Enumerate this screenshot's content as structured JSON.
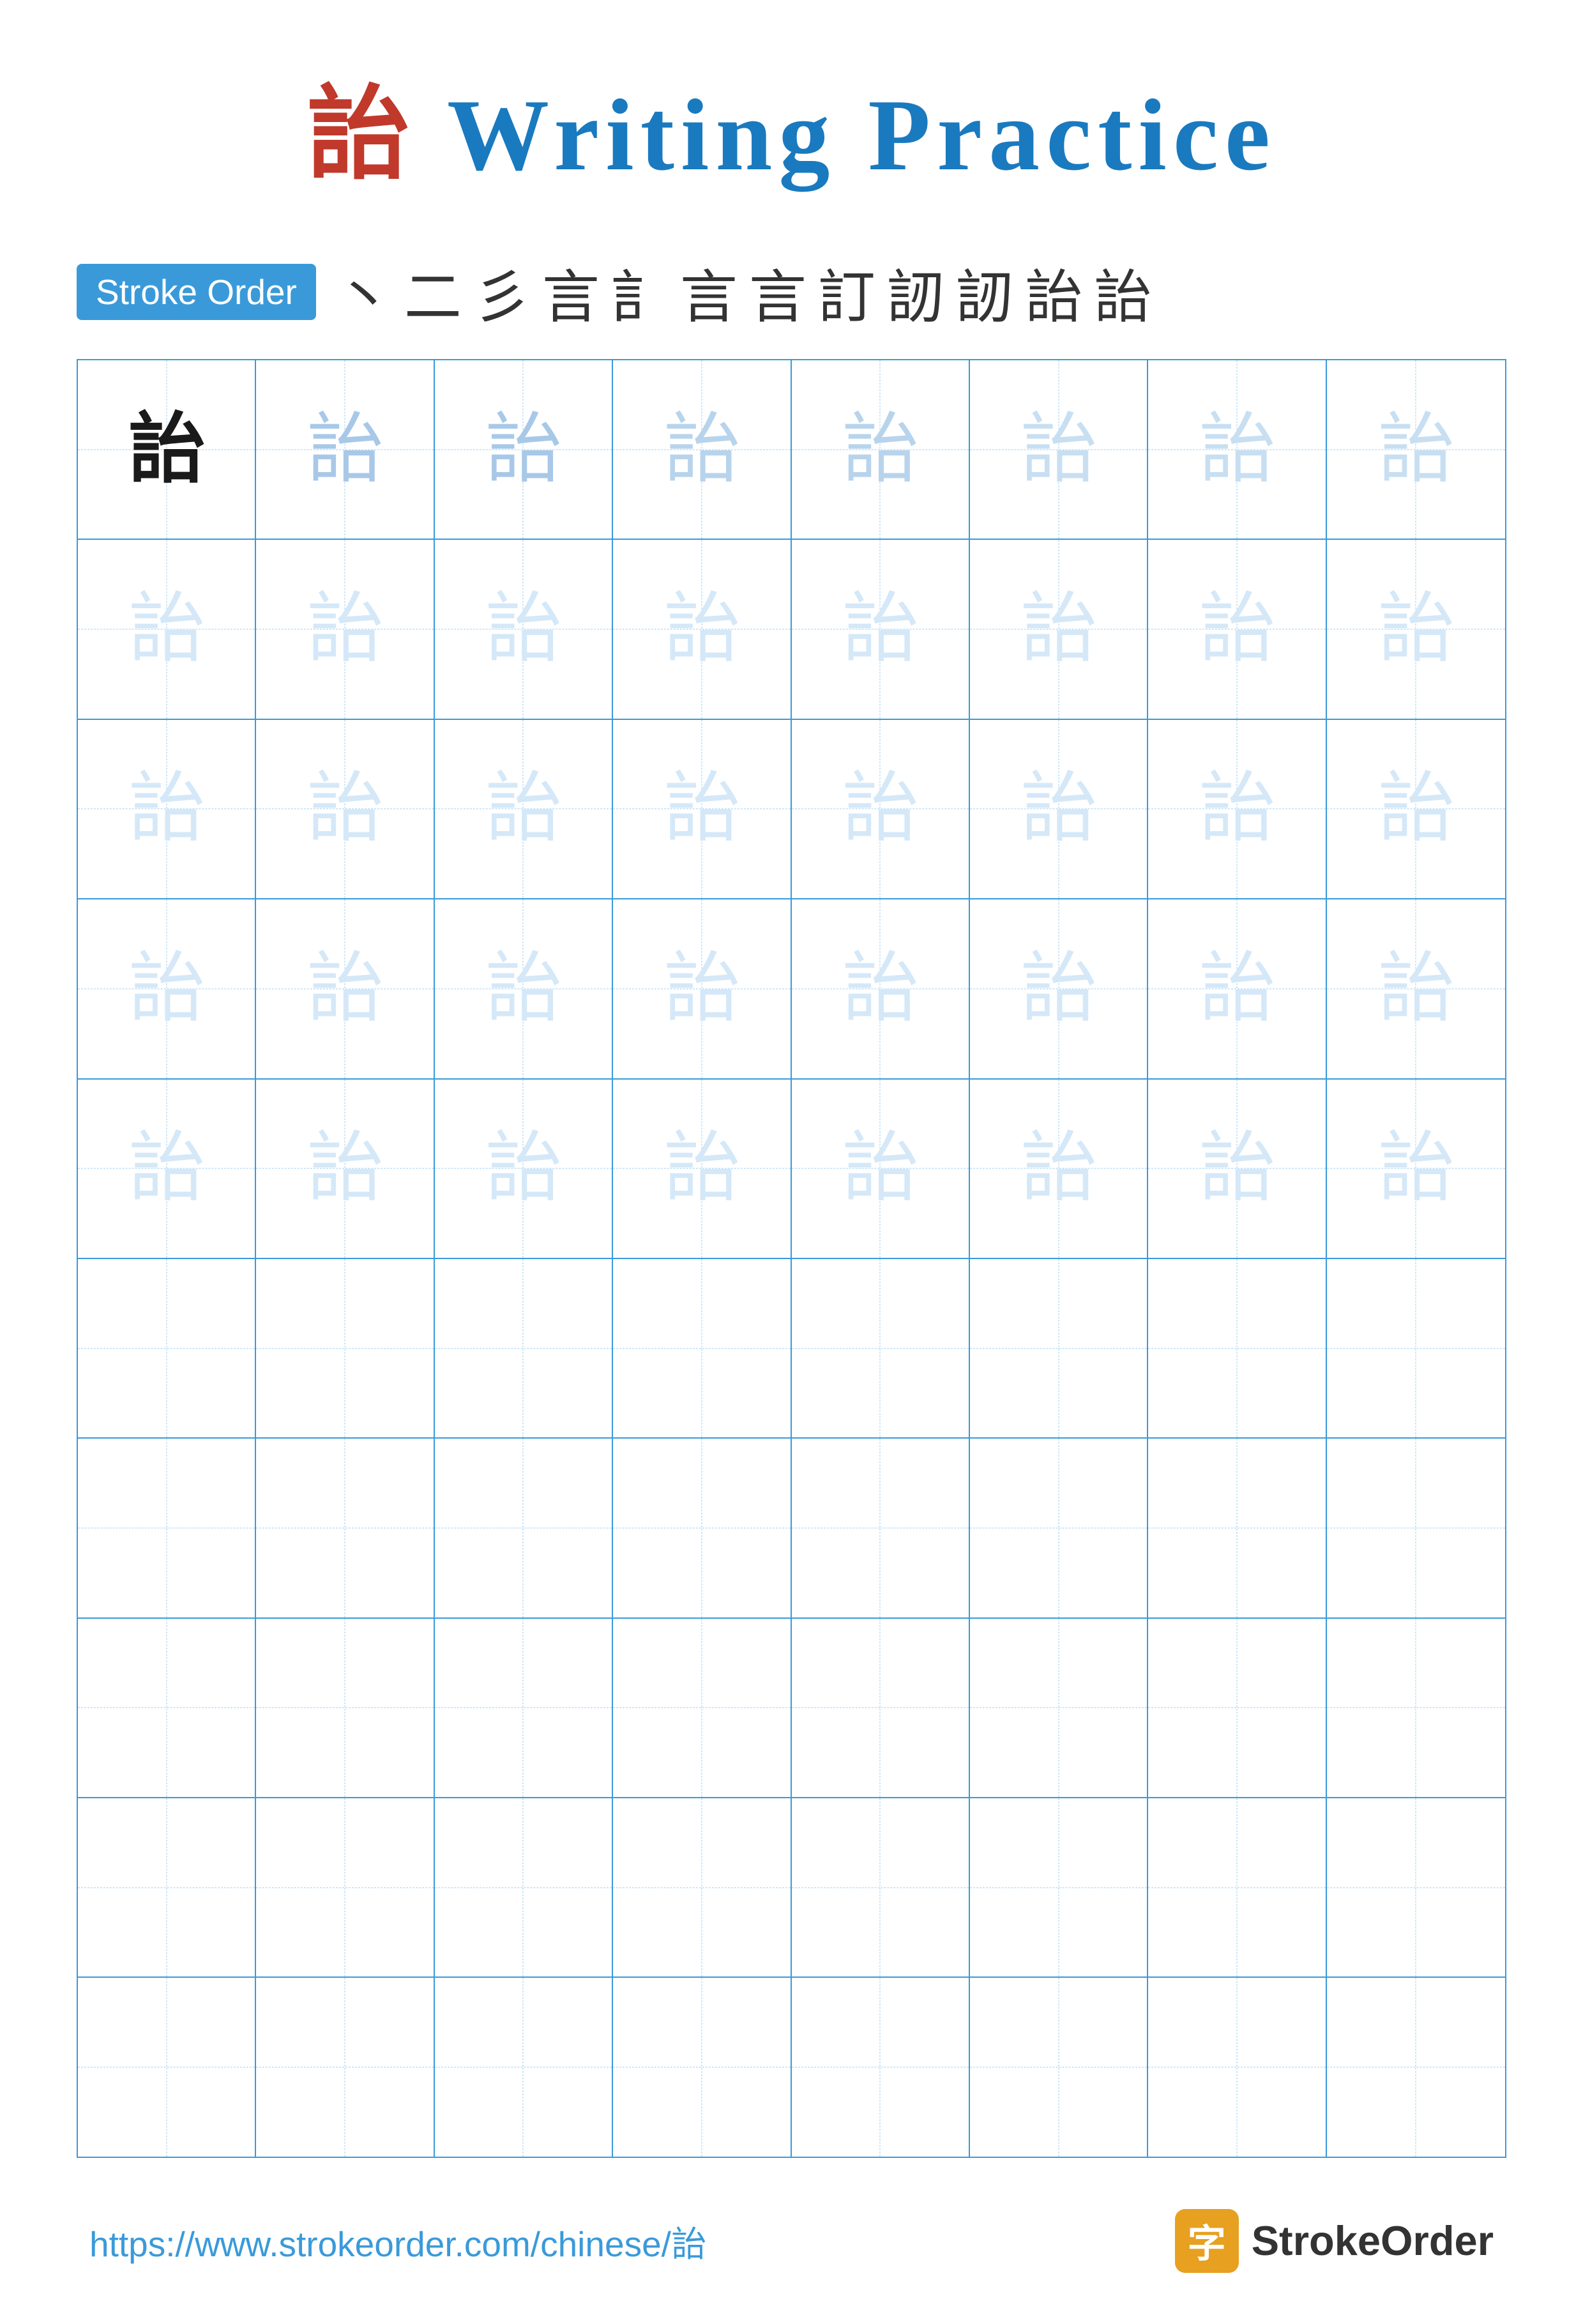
{
  "title": {
    "prefix_char": "詒",
    "text": " Writing Practice"
  },
  "stroke_order": {
    "badge_label": "Stroke Order",
    "chars": [
      "丶",
      "二",
      "彡",
      "言",
      "訁",
      "言",
      "言",
      "訂",
      "訒",
      "訒",
      "詒",
      "詒"
    ]
  },
  "grid": {
    "rows": 10,
    "cols": 8,
    "practice_char": "詒",
    "filled_rows": 5,
    "empty_rows": 5
  },
  "footer": {
    "url": "https://www.strokeorder.com/chinese/詒",
    "brand_name": "StrokeOrder",
    "brand_icon": "字"
  }
}
